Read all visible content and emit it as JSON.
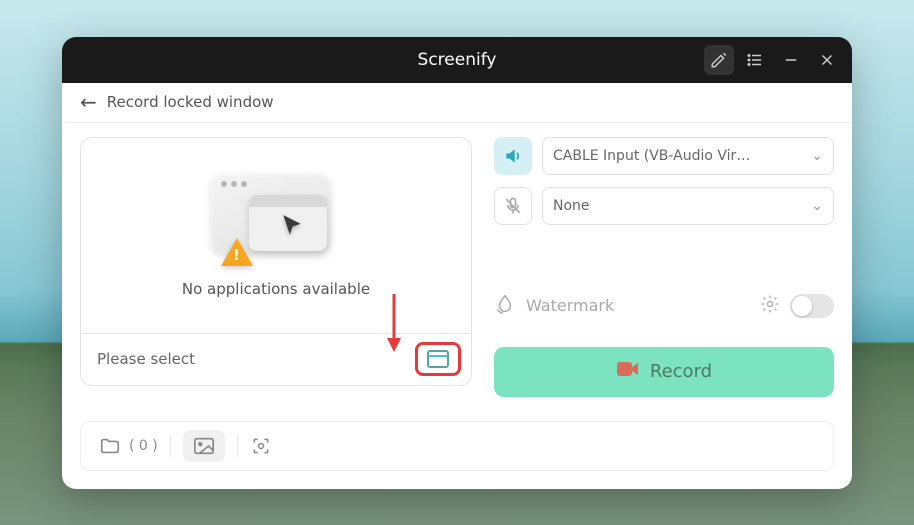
{
  "titlebar": {
    "title": "Screenify"
  },
  "subheader": {
    "title": "Record locked window"
  },
  "preview": {
    "empty_text": "No applications available",
    "select_label": "Please select"
  },
  "audio": {
    "system_output": "CABLE Input (VB-Audio Virtual Cabl...",
    "microphone": "None"
  },
  "watermark": {
    "label": "Watermark",
    "enabled": false
  },
  "record": {
    "label": "Record"
  },
  "bottom": {
    "count_label": "( 0 )"
  },
  "colors": {
    "accent": "#7be3bf",
    "highlight": "#e63939",
    "audio_active": "#2aa5c4"
  }
}
